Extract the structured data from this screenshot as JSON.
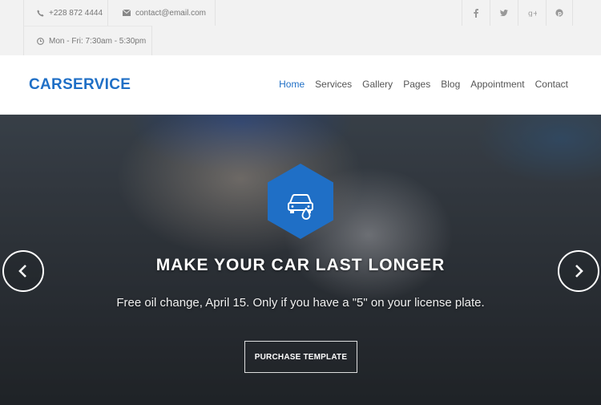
{
  "topbar": {
    "phone": "+228 872 4444",
    "email": "contact@email.com",
    "hours": "Mon - Fri: 7:30am - 5:30pm",
    "social": [
      "facebook-icon",
      "twitter-icon",
      "google-plus-icon",
      "pinterest-icon"
    ]
  },
  "header": {
    "logo": "CARSERVICE",
    "nav": [
      {
        "label": "Home",
        "active": true
      },
      {
        "label": "Services"
      },
      {
        "label": "Gallery"
      },
      {
        "label": "Pages"
      },
      {
        "label": "Blog"
      },
      {
        "label": "Appointment"
      },
      {
        "label": "Contact"
      }
    ]
  },
  "hero": {
    "icon": "car-oil-icon",
    "title": "MAKE YOUR CAR LAST LONGER",
    "subtitle": "Free oil change, April 15. Only if you have a \"5\" on your license plate.",
    "button": "PURCHASE TEMPLATE"
  },
  "colors": {
    "accent": "#1f6fc6",
    "topbar_bg": "#f2f2f2"
  }
}
